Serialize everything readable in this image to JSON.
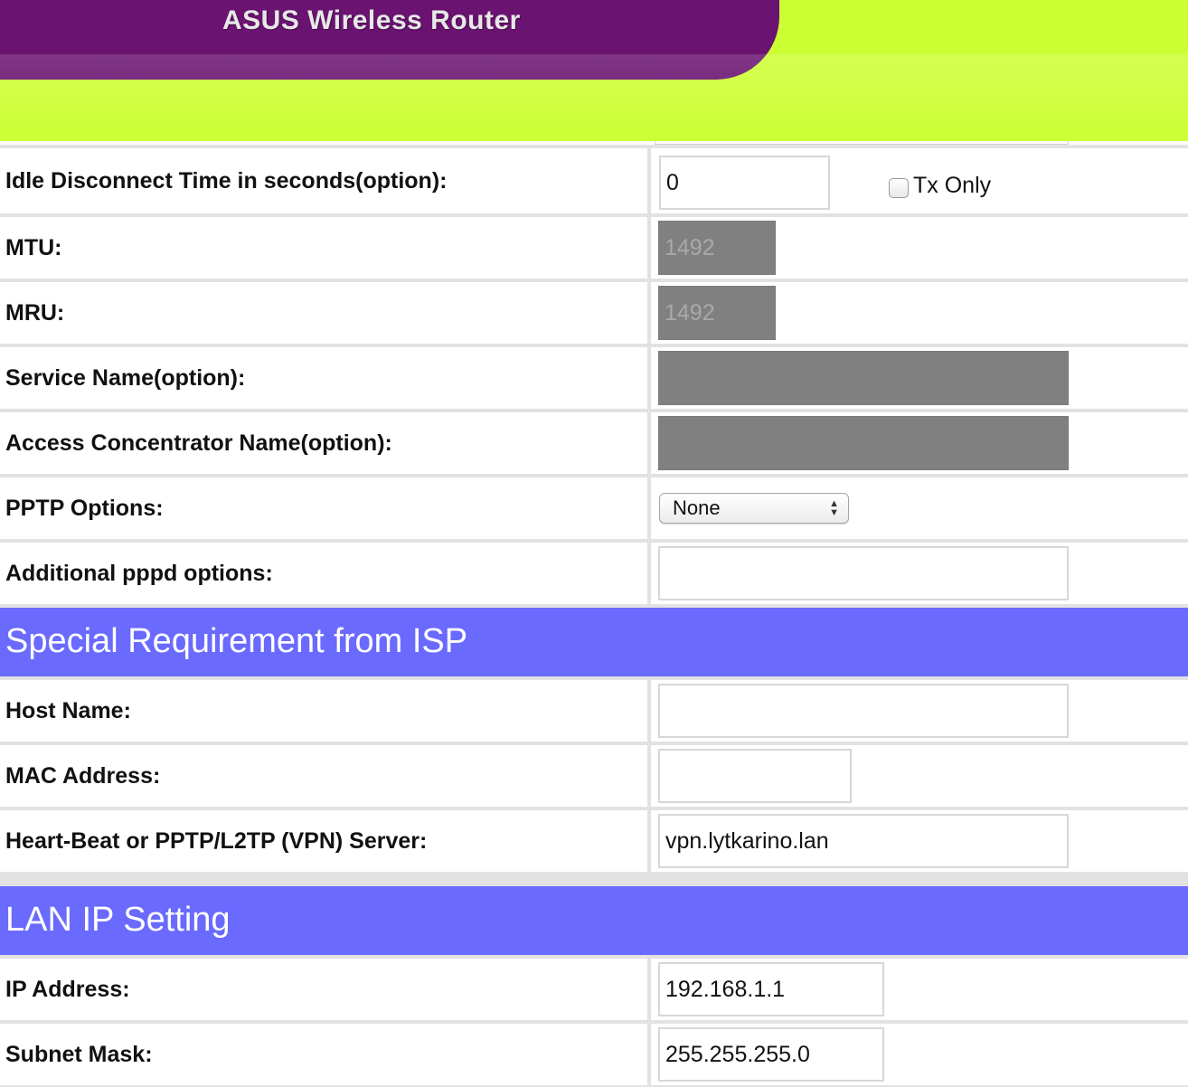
{
  "header": {
    "title": "ASUS Wireless Router"
  },
  "wan_rows": [
    {
      "label": "Idle Disconnect Time in seconds(option):",
      "value": "0",
      "checkbox_label": "Tx Only"
    },
    {
      "label": "MTU:",
      "value": "1492"
    },
    {
      "label": "MRU:",
      "value": "1492"
    },
    {
      "label": "Service Name(option):",
      "value": ""
    },
    {
      "label": "Access Concentrator Name(option):",
      "value": ""
    },
    {
      "label": "PPTP Options:",
      "value": "None"
    },
    {
      "label": "Additional pppd options:",
      "value": ""
    }
  ],
  "special": {
    "title": "Special Requirement from ISP",
    "rows": [
      {
        "label": "Host Name:",
        "value": ""
      },
      {
        "label": "MAC Address:",
        "value": ""
      },
      {
        "label": "Heart-Beat or PPTP/L2TP (VPN) Server:",
        "value": "vpn.lytkarino.lan"
      }
    ]
  },
  "lan": {
    "title": "LAN IP Setting",
    "rows": [
      {
        "label": "IP Address:",
        "value": "192.168.1.1"
      },
      {
        "label": "Subnet Mask:",
        "value": "255.255.255.0"
      }
    ]
  },
  "colors": {
    "banner_green": "#ccff33",
    "banner_purple": "#6a1370",
    "section_blue": "#6a6aff"
  }
}
